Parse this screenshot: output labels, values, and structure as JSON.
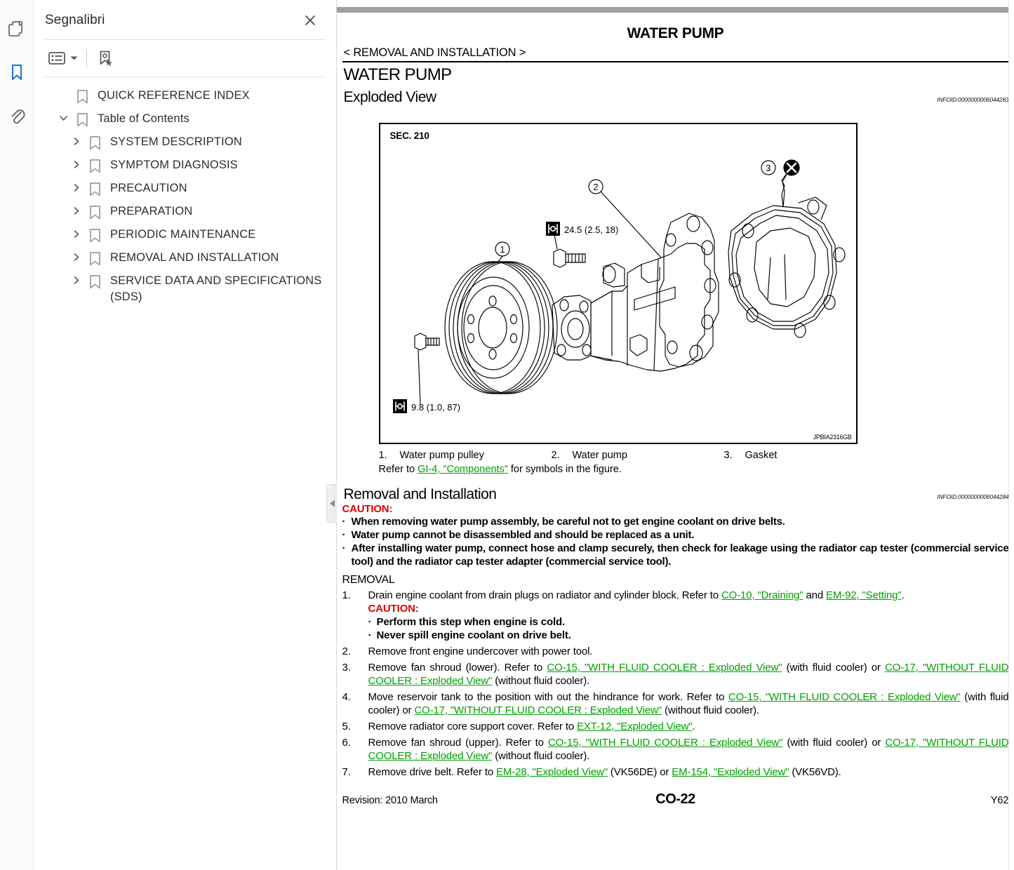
{
  "rail": {
    "items": [
      {
        "name": "page-thumbnails-icon",
        "label": "Page Thumbnails"
      },
      {
        "name": "bookmarks-icon",
        "label": "Bookmarks",
        "active": true
      },
      {
        "name": "attachments-icon",
        "label": "Attachments"
      }
    ]
  },
  "panel": {
    "title": "Segnalibri",
    "close_label": "✕",
    "toolbar": {
      "options_label": "Options",
      "new_bookmark_label": "New Bookmark"
    },
    "bookmarks": [
      {
        "label": "QUICK REFERENCE INDEX",
        "level": 0,
        "expandable": false,
        "expanded": false
      },
      {
        "label": "Table of Contents",
        "level": 1,
        "expandable": true,
        "expanded": true
      },
      {
        "label": "SYSTEM DESCRIPTION",
        "level": 2,
        "expandable": true,
        "expanded": false
      },
      {
        "label": "SYMPTOM DIAGNOSIS",
        "level": 2,
        "expandable": true,
        "expanded": false
      },
      {
        "label": "PRECAUTION",
        "level": 2,
        "expandable": true,
        "expanded": false
      },
      {
        "label": "PREPARATION",
        "level": 2,
        "expandable": true,
        "expanded": false
      },
      {
        "label": "PERIODIC MAINTENANCE",
        "level": 2,
        "expandable": true,
        "expanded": false
      },
      {
        "label": "REMOVAL AND INSTALLATION",
        "level": 2,
        "expandable": true,
        "expanded": false
      },
      {
        "label": "SERVICE DATA AND SPECIFICATIONS (SDS)",
        "level": 2,
        "expandable": true,
        "expanded": false
      }
    ]
  },
  "document": {
    "header_title": "WATER PUMP",
    "breadcrumb": "< REMOVAL AND INSTALLATION >",
    "section_title": "WATER PUMP",
    "exploded_view_heading": "Exploded View",
    "exploded_view_infoid": "INFOID:0000000006044283",
    "figure": {
      "sec_label": "SEC. 210",
      "code": "JPBIA2316GB",
      "callouts": [
        "1",
        "2",
        "3"
      ],
      "torque_upper": "24.5 (2.5, 18)",
      "torque_lower": "9.8 (1.0, 87)"
    },
    "legend": {
      "items": [
        {
          "num": "1.",
          "text": "Water pump pulley"
        },
        {
          "num": "2.",
          "text": "Water pump"
        },
        {
          "num": "3.",
          "text": "Gasket"
        }
      ],
      "note_prefix": "Refer to ",
      "note_link": "GI-4, \"Components\"",
      "note_suffix": " for symbols in the figure."
    },
    "removal_install_heading": "Removal and Installation",
    "removal_install_infoid": "INFOID:0000000006044284",
    "caution": {
      "heading": "CAUTION:",
      "items": [
        "When removing water pump assembly, be careful not to get engine coolant on drive belts.",
        "Water pump cannot be disassembled and should be replaced as a unit.",
        "After installing water pump, connect hose and clamp securely, then check for leakage using the radiator cap tester (commercial service tool) and the radiator cap tester adapter (commercial service tool)."
      ]
    },
    "removal_heading": "REMOVAL",
    "steps": [
      {
        "num": "1.",
        "parts": [
          {
            "t": "Drain engine coolant from drain plugs on radiator and cylinder block. Refer to ",
            "link": false
          },
          {
            "t": "CO-10, \"Draining\"",
            "link": true
          },
          {
            "t": " and ",
            "link": false
          },
          {
            "t": "EM-92, \"Setting\"",
            "link": true
          },
          {
            "t": ".",
            "link": false
          }
        ],
        "caution_heading": "CAUTION:",
        "caution_items": [
          "Perform this step when engine is cold.",
          "Never spill engine coolant on drive belt."
        ]
      },
      {
        "num": "2.",
        "parts": [
          {
            "t": "Remove front engine undercover with power tool.",
            "link": false
          }
        ]
      },
      {
        "num": "3.",
        "parts": [
          {
            "t": "Remove fan shroud (lower). Refer to ",
            "link": false
          },
          {
            "t": "CO-15, \"WITH FLUID COOLER : Exploded View\"",
            "link": true
          },
          {
            "t": " (with fluid cooler) or ",
            "link": false
          },
          {
            "t": "CO-17, \"WITHOUT FLUID COOLER : Exploded View\"",
            "link": true
          },
          {
            "t": " (without fluid cooler).",
            "link": false
          }
        ]
      },
      {
        "num": "4.",
        "parts": [
          {
            "t": "Move reservoir tank to the position with out the hindrance for work. Refer to ",
            "link": false
          },
          {
            "t": "CO-15, \"WITH FLUID COOLER : Exploded View\"",
            "link": true
          },
          {
            "t": " (with fluid cooler) or ",
            "link": false
          },
          {
            "t": "CO-17, \"WITHOUT FLUID COOLER : Exploded View\"",
            "link": true
          },
          {
            "t": " (without fluid cooler).",
            "link": false
          }
        ]
      },
      {
        "num": "5.",
        "parts": [
          {
            "t": "Remove radiator core support cover. Refer to ",
            "link": false
          },
          {
            "t": "EXT-12, \"Exploded View\"",
            "link": true
          },
          {
            "t": ".",
            "link": false
          }
        ]
      },
      {
        "num": "6.",
        "parts": [
          {
            "t": "Remove fan shroud (upper). Refer to ",
            "link": false
          },
          {
            "t": "CO-15, \"WITH FLUID COOLER : Exploded View\"",
            "link": true
          },
          {
            "t": " (with fluid cooler) or ",
            "link": false
          },
          {
            "t": "CO-17, \"WITHOUT FLUID COOLER : Exploded View\"",
            "link": true
          },
          {
            "t": " (without fluid cooler).",
            "link": false
          }
        ]
      },
      {
        "num": "7.",
        "parts": [
          {
            "t": "Remove drive belt. Refer to ",
            "link": false
          },
          {
            "t": "EM-28, \"Exploded View\"",
            "link": true
          },
          {
            "t": " (VK56DE) or ",
            "link": false
          },
          {
            "t": "EM-154, \"Exploded View\"",
            "link": true
          },
          {
            "t": " (VK56VD).",
            "link": false
          }
        ]
      }
    ],
    "footer": {
      "revision": "Revision: 2010 March",
      "page": "CO-22",
      "model": "Y62"
    }
  },
  "colors": {
    "link_green": "#00a000",
    "caution_red": "#e00000",
    "accent_blue": "#1a73c7"
  }
}
